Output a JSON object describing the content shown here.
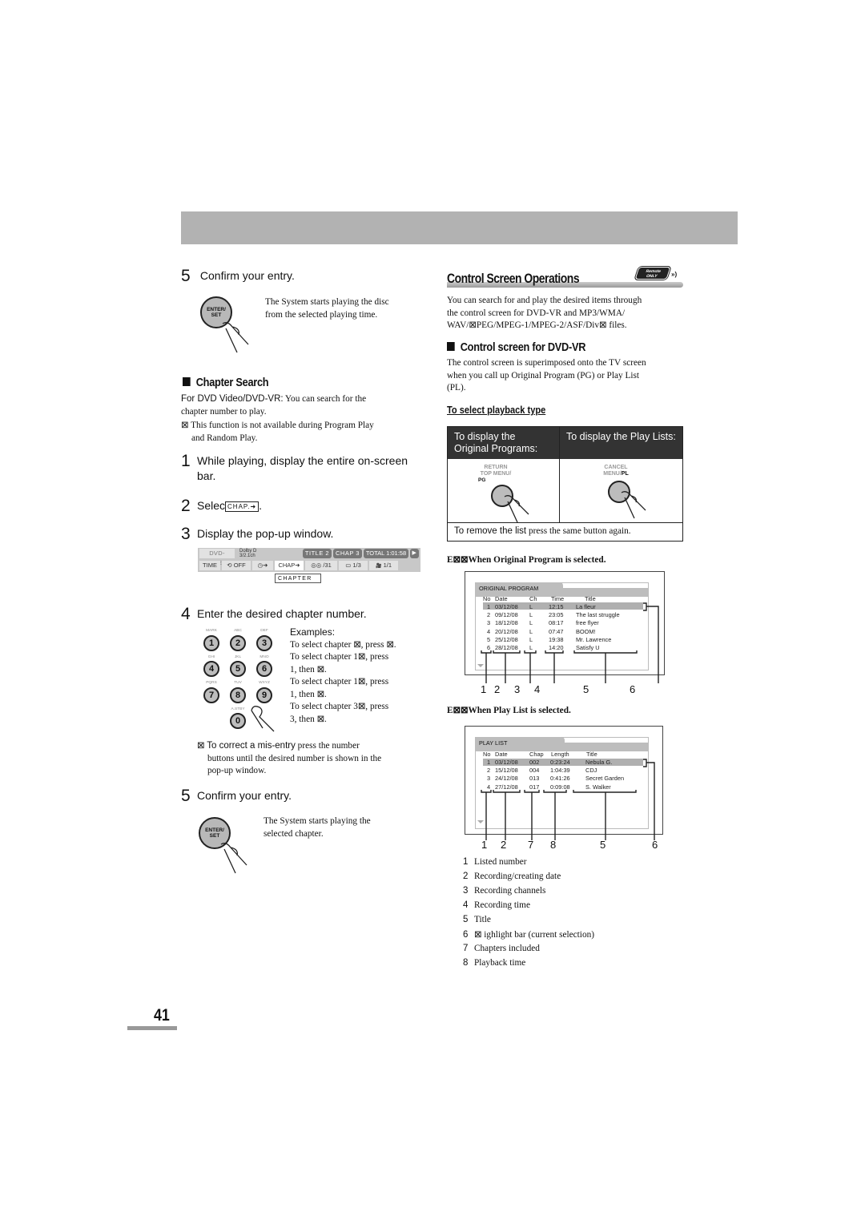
{
  "page": {
    "number": "41"
  },
  "left": {
    "step5_top": {
      "num": "5",
      "text": "Confirm your entry.",
      "button_line1": "ENTER/",
      "button_line2": "SET",
      "desc_line1": "The System starts playing the disc",
      "desc_line2": "from the selected playing time."
    },
    "chapter_search": {
      "title": "Chapter Search",
      "intro_sans": "For DVD Video/DVD-VR:",
      "intro_serif": " You can search for the",
      "intro_line2": "chapter number to play.",
      "note_bullet": "⊠",
      "note_line1": "This function is not available during Program Play",
      "note_line2": "and Random Play."
    },
    "step1": {
      "num": "1",
      "line1": "While playing, display the entire on-screen",
      "line2": "bar."
    },
    "step2": {
      "num": "2",
      "text": "Selec",
      "chip": "CHAP.➜",
      "suffix": "."
    },
    "step3": {
      "num": "3",
      "text": "Display the pop-up window."
    },
    "osd": {
      "disc": "DVD-VIDEO",
      "audio_line1": "Dolby D",
      "audio_line2": "3/2.1ch",
      "title": "TITLE 2",
      "chap": "CHAP 3",
      "total": "TOTAL 1:01:58",
      "play": "▶",
      "time": "TIME",
      "repeat_icon": "⟲",
      "repeat_state": "OFF",
      "clock_icon": "◷➜",
      "chap_btn": "CHAP➜",
      "audio_icon": "◎◎",
      "audio_count": "/31",
      "subtitle_icon": "▭",
      "subtitle_count": "1/3",
      "angle_icon": "🎥",
      "angle_count": "1/1",
      "popup": "CHAPTER"
    },
    "step4": {
      "num": "4",
      "text": "Enter the desired chapter number."
    },
    "keypad": [
      {
        "key": "1",
        "label": "MARK"
      },
      {
        "key": "2",
        "label": "ABC"
      },
      {
        "key": "3",
        "label": "DEF"
      },
      {
        "key": "4",
        "label": "GHI"
      },
      {
        "key": "5",
        "label": "JKL"
      },
      {
        "key": "6",
        "label": "MNO"
      },
      {
        "key": "7",
        "label": "PQRS"
      },
      {
        "key": "8",
        "label": "TUV"
      },
      {
        "key": "9",
        "label": "WXYZ"
      },
      {
        "key": "0",
        "label": "A.STBY"
      }
    ],
    "examples": {
      "heading": "Examples:",
      "lines": [
        "To select chapter ⊠, press ⊠.",
        "To select chapter 1⊠, press",
        "1, then ⊠.",
        "To select chapter 1⊠, press",
        "1, then ⊠.",
        "To select chapter 3⊠, press",
        "3, then ⊠."
      ]
    },
    "correct_note": {
      "bullet": "⊠",
      "sans": "To correct a mis-entry",
      "serif": " press the number",
      "line2": "buttons until the desired number is shown in the",
      "line3": "pop-up window."
    },
    "step5_bottom": {
      "num": "5",
      "text": "Confirm your entry.",
      "button_line1": "ENTER/",
      "button_line2": "SET",
      "desc_line1": "The System starts playing the",
      "desc_line2": "selected chapter."
    }
  },
  "right": {
    "title": "Control Screen Operations",
    "badge_line1": "Remote",
    "badge_line2": "ONLY",
    "badge_arrow": "»)",
    "intro": [
      "You can search for and play the desired items through",
      "the control screen for DVD-VR and MP3/WMA/",
      "WAV/⊠PEG/MPEG-1/MPEG-2/ASF/Div⊠ files."
    ],
    "dvdvr": {
      "title": "Control screen for DVD-VR",
      "desc": [
        "The control screen is superimposed onto the TV screen",
        "when you call up Original Program (PG) or Play List",
        "(PL)."
      ]
    },
    "playback_type": {
      "title": "To select playback type",
      "col1_header_line1": "To display the",
      "col1_header_line2": "Original Programs:",
      "col2_header": "To display the Play Lists:",
      "btn1_line1": "RETURN",
      "btn1_line2": "TOP MENU/",
      "btn1_line3": "PG",
      "btn2_line1": "CANCEL",
      "btn2_line2": "MENU/",
      "btn2_line3": "PL",
      "footer_sans": "To remove the list",
      "footer_serif": " press the same button again."
    },
    "example1": {
      "caption": "E⊠⊠When Original Program is selected.",
      "screen_title": "ORIGINAL PROGRAM",
      "headers": [
        "No",
        "Date",
        "Ch",
        "Time",
        "Title"
      ],
      "rows": [
        [
          "1",
          "03/12/08",
          "L",
          "12:15",
          "La fleur"
        ],
        [
          "2",
          "09/12/08",
          "L",
          "23:05",
          "The last struggle"
        ],
        [
          "3",
          "18/12/08",
          "L",
          "08:17",
          "free flyer"
        ],
        [
          "4",
          "20/12/08",
          "L",
          "07:47",
          "BOOM!"
        ],
        [
          "5",
          "25/12/08",
          "L",
          "19:38",
          "Mr. Lawrence"
        ],
        [
          "6",
          "28/12/08",
          "L",
          "14:20",
          "Satisfy U"
        ]
      ],
      "callouts": [
        "1",
        "2",
        "3",
        "4",
        "5",
        "6"
      ]
    },
    "example2": {
      "caption": "E⊠⊠When Play List is selected.",
      "screen_title": "PLAY LIST",
      "headers": [
        "No",
        "Date",
        "Chap",
        "Length",
        "Title"
      ],
      "rows": [
        [
          "1",
          "03/12/08",
          "002",
          "0:23:24",
          "Nebula G."
        ],
        [
          "2",
          "15/12/08",
          "004",
          "1:04:39",
          "CDJ"
        ],
        [
          "3",
          "24/12/08",
          "013",
          "0:41:26",
          "Secret Garden"
        ],
        [
          "4",
          "27/12/08",
          "017",
          "0:09:08",
          "S. Walker"
        ]
      ],
      "callouts": [
        "1",
        "2",
        "7",
        "8",
        "5",
        "6"
      ]
    },
    "legend": [
      {
        "n": "1",
        "text": "Listed number"
      },
      {
        "n": "2",
        "text": "Recording/creating date"
      },
      {
        "n": "3",
        "text": "Recording channels"
      },
      {
        "n": "4",
        "text": "Recording time"
      },
      {
        "n": "5",
        "text": "Title"
      },
      {
        "n": "6",
        "text": "⊠ ighlight bar (current selection)"
      },
      {
        "n": "7",
        "text": "Chapters included"
      },
      {
        "n": "8",
        "text": "Playback time"
      }
    ]
  }
}
